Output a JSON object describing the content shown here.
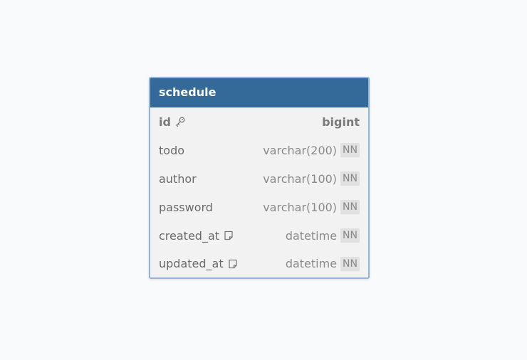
{
  "table": {
    "name": "schedule",
    "fields": [
      {
        "name": "id",
        "type": "bigint",
        "icon": "key-icon",
        "primary": true,
        "constraint": ""
      },
      {
        "name": "todo",
        "type": "varchar(200)",
        "icon": "",
        "primary": false,
        "constraint": "NN"
      },
      {
        "name": "author",
        "type": "varchar(100)",
        "icon": "",
        "primary": false,
        "constraint": "NN"
      },
      {
        "name": "password",
        "type": "varchar(100)",
        "icon": "",
        "primary": false,
        "constraint": "NN"
      },
      {
        "name": "created_at",
        "type": "datetime",
        "icon": "note-icon",
        "primary": false,
        "constraint": "NN"
      },
      {
        "name": "updated_at",
        "type": "datetime",
        "icon": "note-icon",
        "primary": false,
        "constraint": "NN"
      }
    ]
  },
  "colors": {
    "header_bg": "#336a9a",
    "border": "#8fb4dd",
    "body_bg": "#f2f2f2",
    "badge_bg": "#e1e1e1"
  }
}
